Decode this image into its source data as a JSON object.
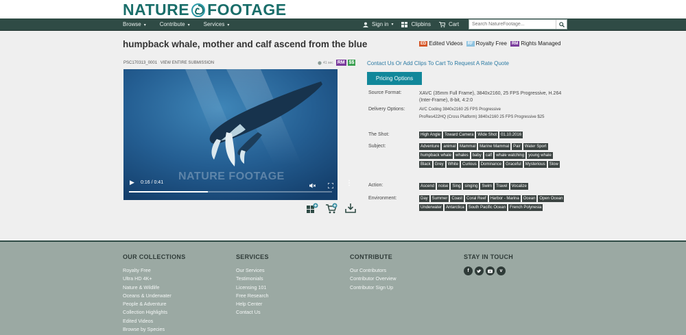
{
  "brand": {
    "logo_left": "NATURE",
    "logo_right": "FOOTAGE"
  },
  "nav": {
    "items": [
      {
        "label": "Browse"
      },
      {
        "label": "Contribute"
      },
      {
        "label": "Services"
      }
    ],
    "signin": "Sign in",
    "clipbins": "Clipbins",
    "cart": "Cart",
    "search_placeholder": "Search NatureFootage..."
  },
  "title": "humpback whale, mother and calf ascend from the blue",
  "legend": {
    "ed_badge": "ED",
    "ed_label": "Edited Videos",
    "rf_badge": "RF",
    "rf_label": "Royalty Free",
    "rm_badge": "RM",
    "rm_label": "Rights Managed"
  },
  "clip": {
    "id": "PSC170313_0001",
    "view_all": "VIEW ENTIRE SUBMISSION",
    "duration_small": "41 sec",
    "rm_badge": "RM",
    "price_badge": "$$",
    "watermark": "NATURE FOOTAGE",
    "time": "0:16 / 0:41",
    "progress": 0.39
  },
  "request_link": "Contact Us Or Add Clips To Cart To Request A Rate Quote",
  "pricing_button": "Pricing Options",
  "details": {
    "source_label": "Source Format:",
    "source_value_1": "XAVC (35mm Full Frame), 3840x2160, 25 FPS Progressive, H.264",
    "source_value_2": "(Inter-Frame), 8-bit, 4:2:0",
    "delivery_label": "Delivery Options:",
    "delivery_1": "AVC Coding 3840x2160 25 FPS Progressive",
    "delivery_2": "ProRes422HQ (Cross Platform) 3840x2160 25 FPS Progressive $25",
    "shot_label": "The Shot:",
    "shot_tags": [
      "High Angle",
      "Toward Camera",
      "Wide Shot",
      "01.10.2016"
    ],
    "subject_label": "Subject:",
    "subject_tags": [
      "Adventure",
      "animal",
      "Mammal",
      "Marine Mammal",
      "Pair",
      "Water Sport",
      "humpback whale",
      "whales",
      "baby",
      "calf",
      "whale watching",
      "young whale",
      "Black",
      "Grey",
      "White",
      "Curious",
      "Dominance",
      "Graceful",
      "Mysterious",
      "Slow"
    ],
    "action_label": "Action:",
    "action_tags": [
      "Ascend",
      "noise",
      "Sing",
      "singing",
      "Swim",
      "Travel",
      "Vocalize"
    ],
    "environment_label": "Environment:",
    "environment_tags": [
      "Day",
      "Summer",
      "Coast",
      "Coral Reef",
      "Harbor - Marina",
      "Ocean",
      "Open Ocean",
      "Underwater",
      "Antarctica",
      "South Pacific Ocean",
      "French Polynesia"
    ]
  },
  "footer": {
    "collections_title": "OUR COLLECTIONS",
    "collections": [
      "Royalty Free",
      "Ultra HD 4K+",
      "Nature & Wildlife",
      "Oceans & Underwater",
      "People & Adventure",
      "Collection Highlights",
      "Edited Videos",
      "Browse by Species"
    ],
    "services_title": "SERVICES",
    "services": [
      "Our Services",
      "Testimonials",
      "Licensing 101",
      "Free Research",
      "Help Center",
      "Contact Us"
    ],
    "contribute_title": "CONTRIBUTE",
    "contribute": [
      "Our Contributors",
      "Contributor Overview",
      "Contributor Sign Up"
    ],
    "touch_title": "STAY IN TOUCH"
  },
  "colors": {
    "brand": "#1a6e6a",
    "nav_bg": "#2f4b45",
    "footer_bg": "#9ba9a3",
    "pricing_btn": "#11879a",
    "link": "#2a7aa3"
  }
}
